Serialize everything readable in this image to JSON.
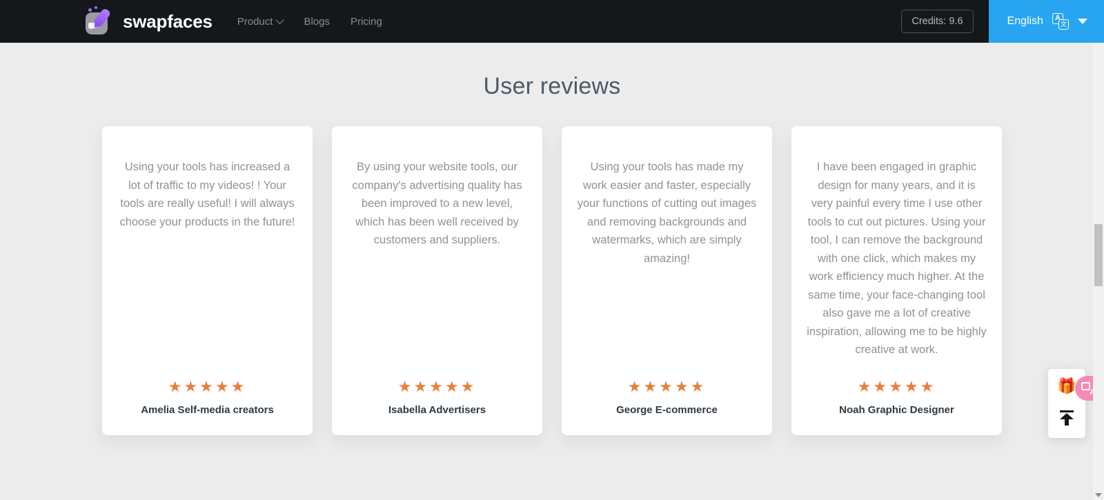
{
  "header": {
    "brand_name": "swapfaces",
    "logo_icon": "swapfaces-logo-icon",
    "nav": [
      {
        "label": "Product",
        "has_dropdown": true
      },
      {
        "label": "Blogs",
        "has_dropdown": false
      },
      {
        "label": "Pricing",
        "has_dropdown": false
      }
    ],
    "credits_label": "Credits: 9.6",
    "language": {
      "label": "English",
      "icon": "translate-icon",
      "caret": "chevron-down-icon"
    },
    "background_color": "#15181a",
    "accent_color": "#27a5f0"
  },
  "main": {
    "title": "User reviews",
    "background_color": "#ececec",
    "title_color": "#4b5a68",
    "star_color": "#e8803a",
    "reviews": [
      {
        "text": "Using your tools has increased a lot of traffic to my videos! ! Your tools are really useful! I will always choose your products in the future!",
        "stars": "★★★★★",
        "rating": 5,
        "author": "Amelia Self-media creators"
      },
      {
        "text": "By using your website tools, our company's advertising quality has been improved to a new level, which has been well received by customers and suppliers.",
        "stars": "★★★★★",
        "rating": 5,
        "author": "Isabella Advertisers"
      },
      {
        "text": "Using your tools has made my work easier and faster, especially your functions of cutting out images and removing backgrounds and watermarks, which are simply amazing!",
        "stars": "★★★★★",
        "rating": 5,
        "author": "George E-commerce"
      },
      {
        "text": "I have been engaged in graphic design for many years, and it is very painful every time I use other tools to cut out pictures. Using your tool, I can remove the background with one click, which makes my work efficiency much higher. At the same time, your face-changing tool also gave me a lot of creative inspiration, allowing me to be highly creative at work.",
        "stars": "★★★★★",
        "rating": 5,
        "author": "Noah Graphic Designer"
      }
    ]
  },
  "floating_widget": {
    "gift_icon": "gift-icon",
    "gift_glyph": "🎁",
    "back_to_top_icon": "back-to-top-icon",
    "translate_bubble_icon": "translate-bubble-icon",
    "bubble_color": "#f48bb4"
  },
  "scrollbar": {
    "track_color": "#f1f1f1",
    "thumb_color": "#c1c1c1",
    "down_arrow_icon": "scroll-down-arrow-icon"
  }
}
